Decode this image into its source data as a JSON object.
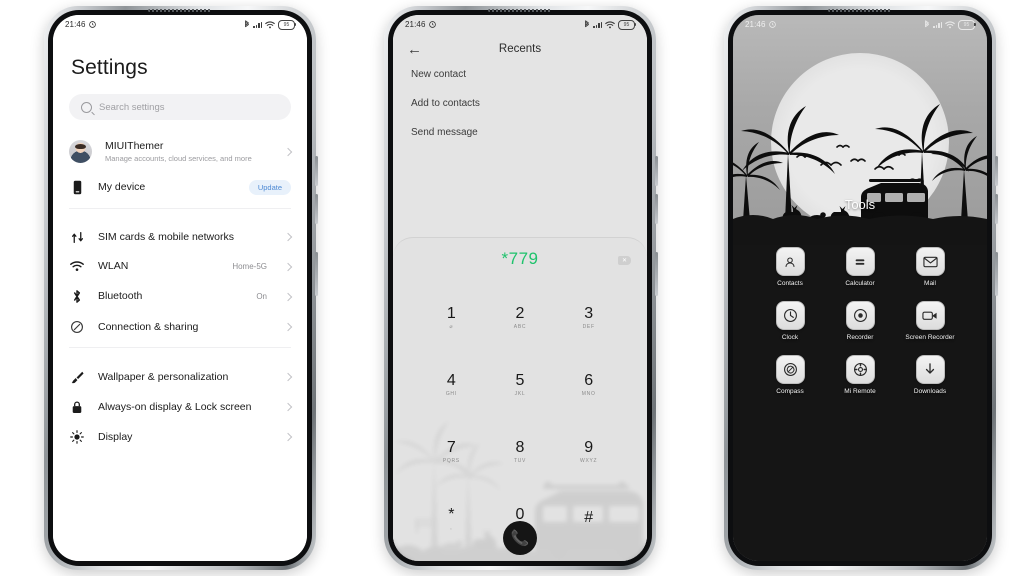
{
  "page": {
    "background_color": "#ffffff",
    "device_count": 3
  },
  "status_bar": {
    "time": "21:46",
    "alarm_icon": "alarm-icon",
    "bluetooth_icon": "bluetooth-icon",
    "signal_icon": "signal-bars-icon",
    "wifi_icon": "wifi-icon",
    "battery_icon": "battery-icon",
    "battery_level": "95"
  },
  "phone1": {
    "name": "settings-screen",
    "title": "Settings",
    "search": {
      "placeholder": "Search settings",
      "icon": "search-icon"
    },
    "account": {
      "name": "MIUIThemer",
      "subtitle": "Manage accounts, cloud services, and more",
      "avatar": "user-avatar"
    },
    "device": {
      "label": "My device",
      "badge": "Update",
      "badge_color": "#4e8ad4",
      "icon": "phone-icon"
    },
    "groups": [
      {
        "items": [
          {
            "label": "SIM cards & mobile networks",
            "value": "",
            "icon": "sim-signal-icon"
          },
          {
            "label": "WLAN",
            "value": "Home-5G",
            "icon": "wifi-icon"
          },
          {
            "label": "Bluetooth",
            "value": "On",
            "icon": "bluetooth-icon"
          },
          {
            "label": "Connection & sharing",
            "value": "",
            "icon": "link-icon"
          }
        ]
      },
      {
        "items": [
          {
            "label": "Wallpaper & personalization",
            "value": "",
            "icon": "brush-icon"
          },
          {
            "label": "Always-on display & Lock screen",
            "value": "",
            "icon": "lock-icon"
          },
          {
            "label": "Display",
            "value": "",
            "icon": "brightness-icon"
          }
        ]
      }
    ]
  },
  "phone2": {
    "name": "dialer-screen",
    "header": {
      "title": "Recents",
      "back_icon": "back-arrow-icon"
    },
    "menu_items": [
      "New contact",
      "Add to contacts",
      "Send message"
    ],
    "dialed_number": "*779",
    "dialed_number_color": "#1fc26c",
    "delete_icon": "backspace-icon",
    "call_icon": "phone-call-icon",
    "keypad": [
      {
        "num": "1",
        "sub": "⌀"
      },
      {
        "num": "2",
        "sub": "ABC"
      },
      {
        "num": "3",
        "sub": "DEF"
      },
      {
        "num": "4",
        "sub": "GHI"
      },
      {
        "num": "5",
        "sub": "JKL"
      },
      {
        "num": "6",
        "sub": "MNO"
      },
      {
        "num": "7",
        "sub": "PQRS"
      },
      {
        "num": "8",
        "sub": "TUV"
      },
      {
        "num": "9",
        "sub": "WXYZ"
      },
      {
        "num": "*",
        "sub": ","
      },
      {
        "num": "0",
        "sub": "+"
      },
      {
        "num": "#",
        "sub": ""
      }
    ]
  },
  "phone3": {
    "name": "home-folder-screen",
    "folder_title": "Tools",
    "apps": [
      {
        "label": "Contacts",
        "icon": "contacts-icon"
      },
      {
        "label": "Calculator",
        "icon": "calculator-icon"
      },
      {
        "label": "Mail",
        "icon": "mail-icon"
      },
      {
        "label": "Clock",
        "icon": "clock-icon"
      },
      {
        "label": "Recorder",
        "icon": "recorder-icon"
      },
      {
        "label": "Screen Recorder",
        "icon": "screen-recorder-icon"
      },
      {
        "label": "Compass",
        "icon": "compass-icon"
      },
      {
        "label": "Mi Remote",
        "icon": "remote-icon"
      },
      {
        "label": "Downloads",
        "icon": "download-icon"
      }
    ]
  }
}
